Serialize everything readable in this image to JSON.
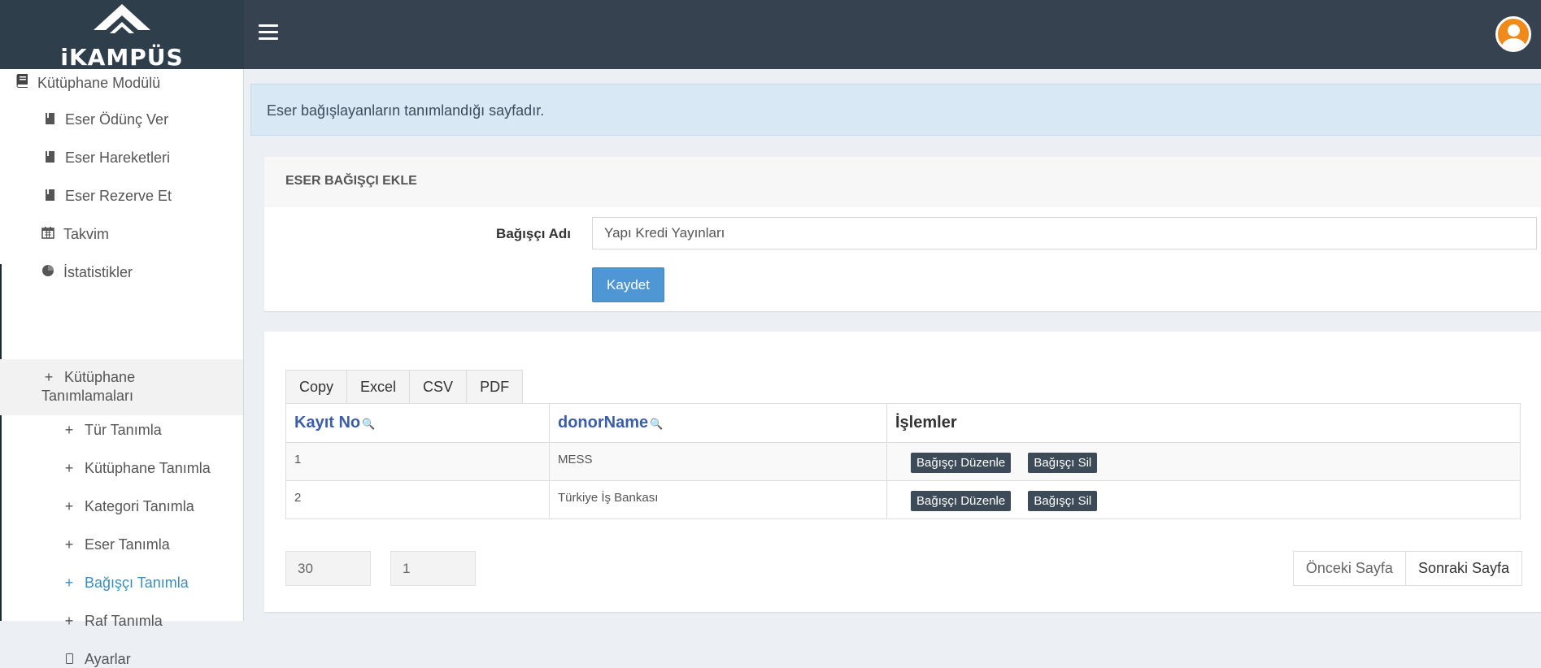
{
  "brand": {
    "logo_text": "iKAMPÜS",
    "accent_color": "#3c8dbc",
    "header_color": "#364250"
  },
  "header": {
    "menu_icon": "hamburger-icon",
    "avatar_icon": "user-avatar-icon"
  },
  "sidebar": {
    "module": {
      "label": "Kütüphane Modülü",
      "icon": "book-icon"
    },
    "items": [
      {
        "label": "Eser Ödünç Ver",
        "icon": "bookmark-icon"
      },
      {
        "label": "Eser Hareketleri",
        "icon": "bookmark-icon"
      },
      {
        "label": "Eser Rezerve Et",
        "icon": "bookmark-icon"
      },
      {
        "label": "Takvim",
        "icon": "calendar-icon"
      },
      {
        "label": "İstatistikler",
        "icon": "pie-chart-icon"
      }
    ],
    "group": {
      "label_line1": "Kütüphane",
      "label_line2": "Tanımlamaları",
      "icon": "plus-icon"
    },
    "sub_items": [
      {
        "label": "Tür Tanımla",
        "icon": "plus-icon"
      },
      {
        "label": "Kütüphane Tanımla",
        "icon": "plus-icon"
      },
      {
        "label": "Kategori Tanımla",
        "icon": "plus-icon"
      },
      {
        "label": "Eser Tanımla",
        "icon": "plus-icon"
      },
      {
        "label": "Bağışçı Tanımla",
        "icon": "plus-icon",
        "active": true
      },
      {
        "label": "Raf Tanımla",
        "icon": "plus-icon"
      }
    ],
    "settings": {
      "label": "Ayarlar",
      "icon": "mobile-icon"
    }
  },
  "callout": {
    "text": "Eser bağışlayanların tanımlandığı sayfadır."
  },
  "form": {
    "title": "ESER BAĞIŞÇI EKLE",
    "field_label": "Bağışçı Adı",
    "field_value": "Yapı Kredi Yayınları",
    "save_label": "Kaydet"
  },
  "table": {
    "export_buttons": [
      "Copy",
      "Excel",
      "CSV",
      "PDF"
    ],
    "columns": [
      "Kayıt No",
      "donorName",
      "İşlemler"
    ],
    "rows": [
      {
        "id": "1",
        "name": "MESS",
        "edit": "Bağışçı Düzenle",
        "delete": "Bağışçı Sil"
      },
      {
        "id": "2",
        "name": "Türkiye İş Bankası",
        "edit": "Bağışçı Düzenle",
        "delete": "Bağışçı Sil"
      }
    ],
    "page_size": "30",
    "page_number": "1",
    "prev_label": "Önceki Sayfa",
    "next_label": "Sonraki Sayfa"
  }
}
